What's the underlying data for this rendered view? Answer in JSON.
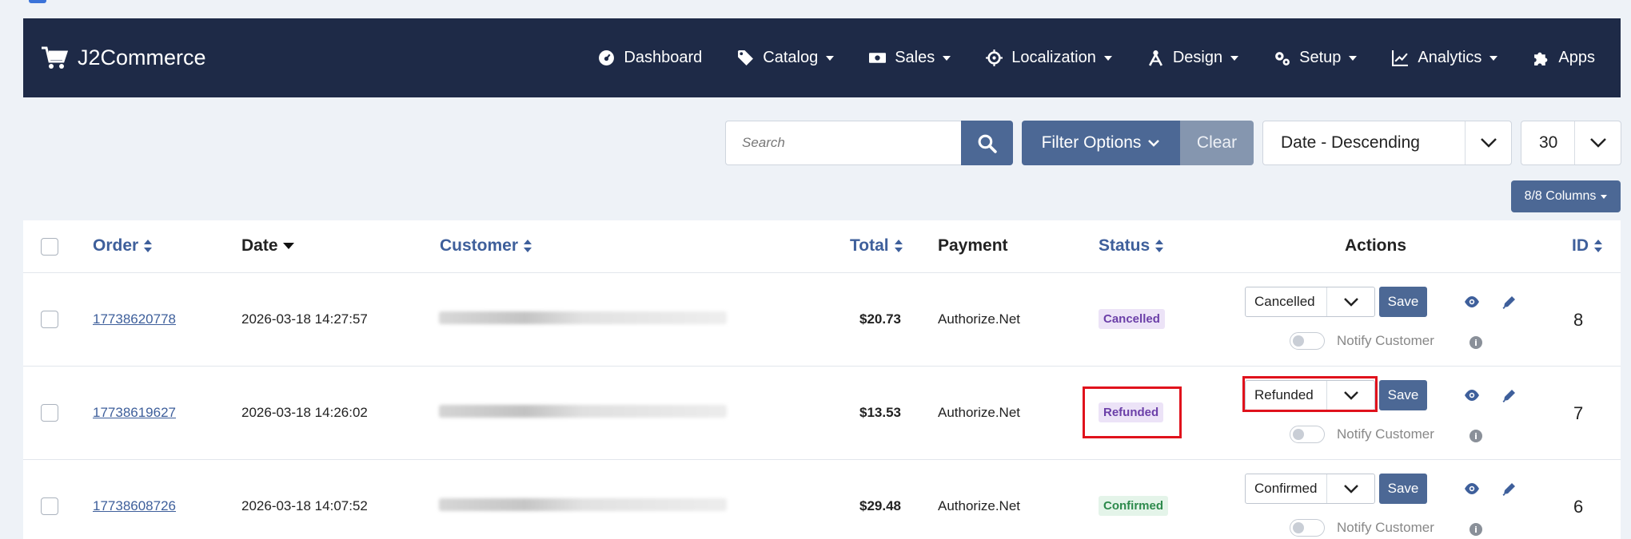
{
  "brand": {
    "name": "J2Commerce"
  },
  "nav": [
    {
      "label": "Dashboard",
      "icon": "dashboard-icon",
      "has_caret": false
    },
    {
      "label": "Catalog",
      "icon": "tag-icon",
      "has_caret": true
    },
    {
      "label": "Sales",
      "icon": "money-icon",
      "has_caret": true
    },
    {
      "label": "Localization",
      "icon": "crosshair-icon",
      "has_caret": true
    },
    {
      "label": "Design",
      "icon": "design-icon",
      "has_caret": true
    },
    {
      "label": "Setup",
      "icon": "gears-icon",
      "has_caret": true
    },
    {
      "label": "Analytics",
      "icon": "chart-icon",
      "has_caret": true
    },
    {
      "label": "Apps",
      "icon": "puzzle-icon",
      "has_caret": false
    }
  ],
  "toolbar": {
    "search_placeholder": "Search",
    "filter_label": "Filter Options",
    "clear_label": "Clear",
    "sort_value": "Date - Descending",
    "limit_value": "30",
    "columns_label": "8/8 Columns"
  },
  "table": {
    "headers": {
      "order": "Order",
      "date": "Date",
      "customer": "Customer",
      "total": "Total",
      "payment": "Payment",
      "status": "Status",
      "actions": "Actions",
      "id": "ID"
    },
    "rows": [
      {
        "order": "17738620778",
        "date": "2026-03-18 14:27:57",
        "total": "$20.73",
        "payment": "Authorize.Net",
        "status": "Cancelled",
        "select": "Cancelled",
        "save": "Save",
        "notify": "Notify Customer",
        "id": "8"
      },
      {
        "order": "17738619627",
        "date": "2026-03-18 14:26:02",
        "total": "$13.53",
        "payment": "Authorize.Net",
        "status": "Refunded",
        "select": "Refunded",
        "save": "Save",
        "notify": "Notify Customer",
        "id": "7"
      },
      {
        "order": "17738608726",
        "date": "2026-03-18 14:07:52",
        "total": "$29.48",
        "payment": "Authorize.Net",
        "status": "Confirmed",
        "select": "Confirmed",
        "save": "Save",
        "notify": "Notify Customer",
        "id": "6"
      }
    ]
  },
  "colors": {
    "navbar": "#1e2a47",
    "primary": "#4c6895",
    "link": "#3e5f9b",
    "highlight": "#e0121c"
  }
}
